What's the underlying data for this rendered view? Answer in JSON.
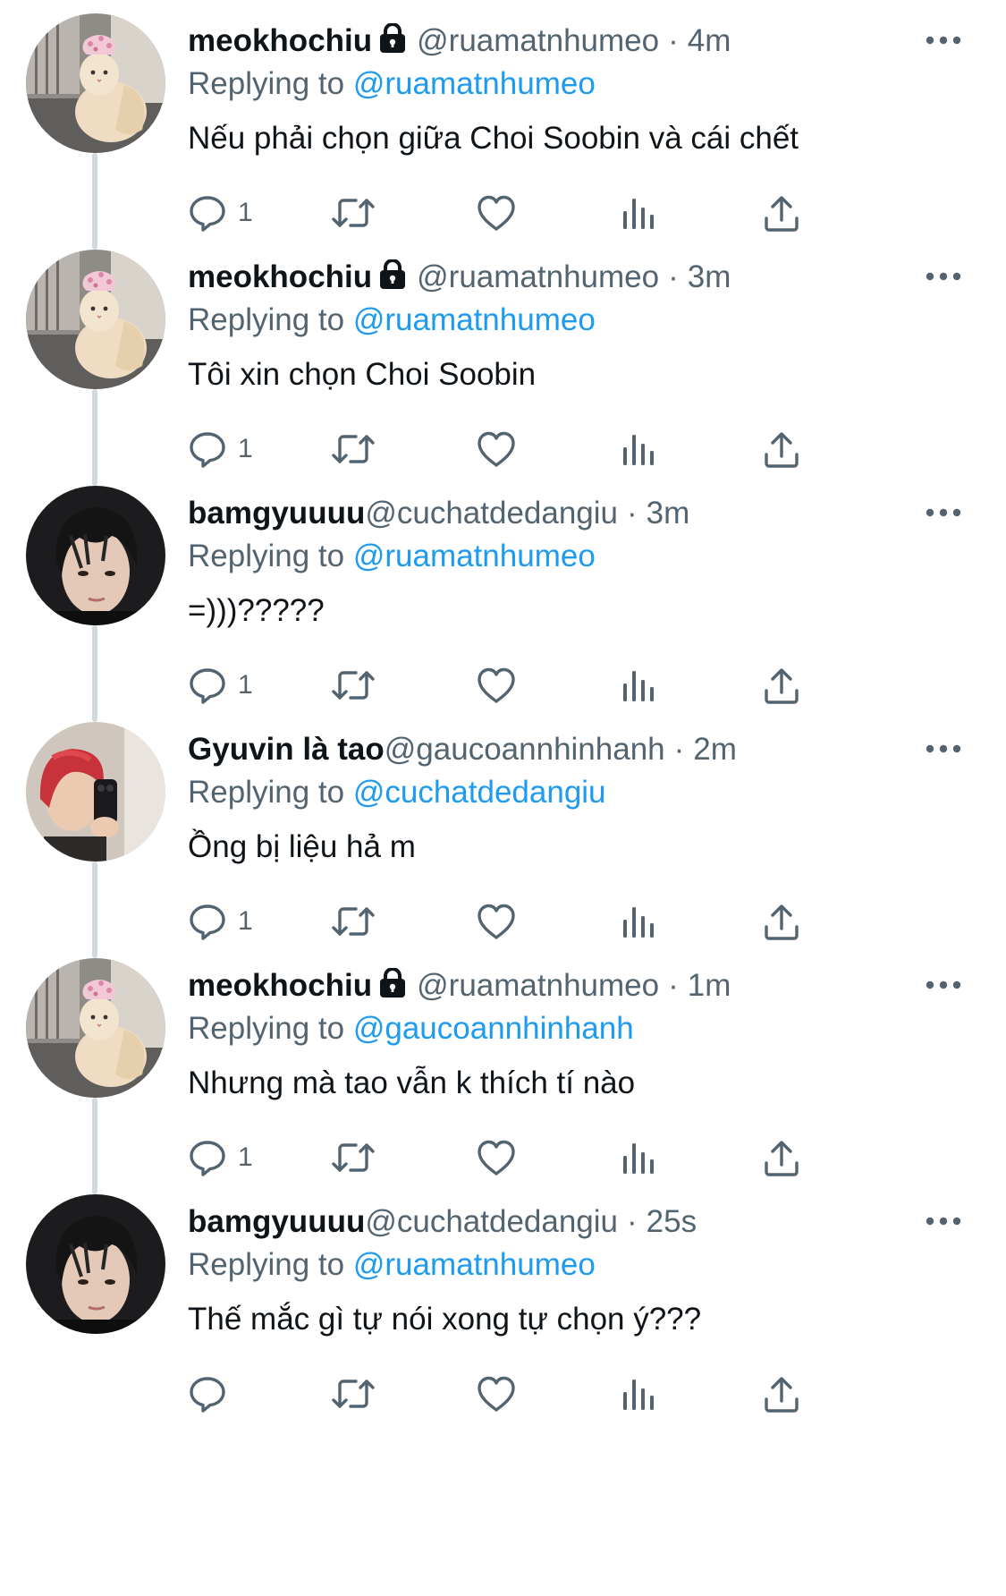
{
  "replying_to_label": "Replying to",
  "tweets": [
    {
      "name": "meokhochiu",
      "locked": true,
      "handle": "@ruamatnhumeo",
      "dot": "·",
      "time": "4m",
      "replying_to": "@ruamatnhumeo",
      "text": "Nếu phải chọn giữa Choi Soobin và cái chết",
      "reply_count": "1",
      "avatar": "cat"
    },
    {
      "name": "meokhochiu",
      "locked": true,
      "handle": "@ruamatnhumeo",
      "dot": "·",
      "time": "3m",
      "replying_to": "@ruamatnhumeo",
      "text": "Tôi xin chọn Choi Soobin",
      "reply_count": "1",
      "avatar": "cat"
    },
    {
      "name": "bamgyuuuu",
      "locked": false,
      "handle": "@cuchatdedangiu",
      "dot": "·",
      "time": "3m",
      "replying_to": "@ruamatnhumeo",
      "text": "=)))?????",
      "reply_count": "1",
      "avatar": "dark-hair-person"
    },
    {
      "name": "Gyuvin là tao",
      "locked": false,
      "handle": "@gaucoannhinhanh",
      "dot": "·",
      "time": "2m",
      "replying_to": "@cuchatdedangiu",
      "text": "Ồng bị liệu hả m",
      "reply_count": "1",
      "avatar": "red-hair-selfie"
    },
    {
      "name": "meokhochiu",
      "locked": true,
      "handle": "@ruamatnhumeo",
      "dot": "·",
      "time": "1m",
      "replying_to": "@gaucoannhinhanh",
      "text": "Nhưng mà tao vẫn k thích tí nào",
      "reply_count": "1",
      "avatar": "cat"
    },
    {
      "name": "bamgyuuuu",
      "locked": false,
      "handle": "@cuchatdedangiu",
      "dot": "·",
      "time": "25s",
      "replying_to": "@ruamatnhumeo",
      "text": "Thế mắc gì tự nói xong tự chọn ý???",
      "reply_count": "",
      "avatar": "dark-hair-person"
    }
  ],
  "icons": {
    "more": "more-options-icon",
    "lock": "lock-icon",
    "reply": "reply-icon",
    "retweet": "retweet-icon",
    "like": "like-heart-icon",
    "views": "views-chart-icon",
    "share": "share-icon"
  },
  "colors": {
    "text": "#0f1419",
    "secondary": "#536471",
    "mention": "#1d9bf0",
    "thread_line": "#cfd9de"
  }
}
